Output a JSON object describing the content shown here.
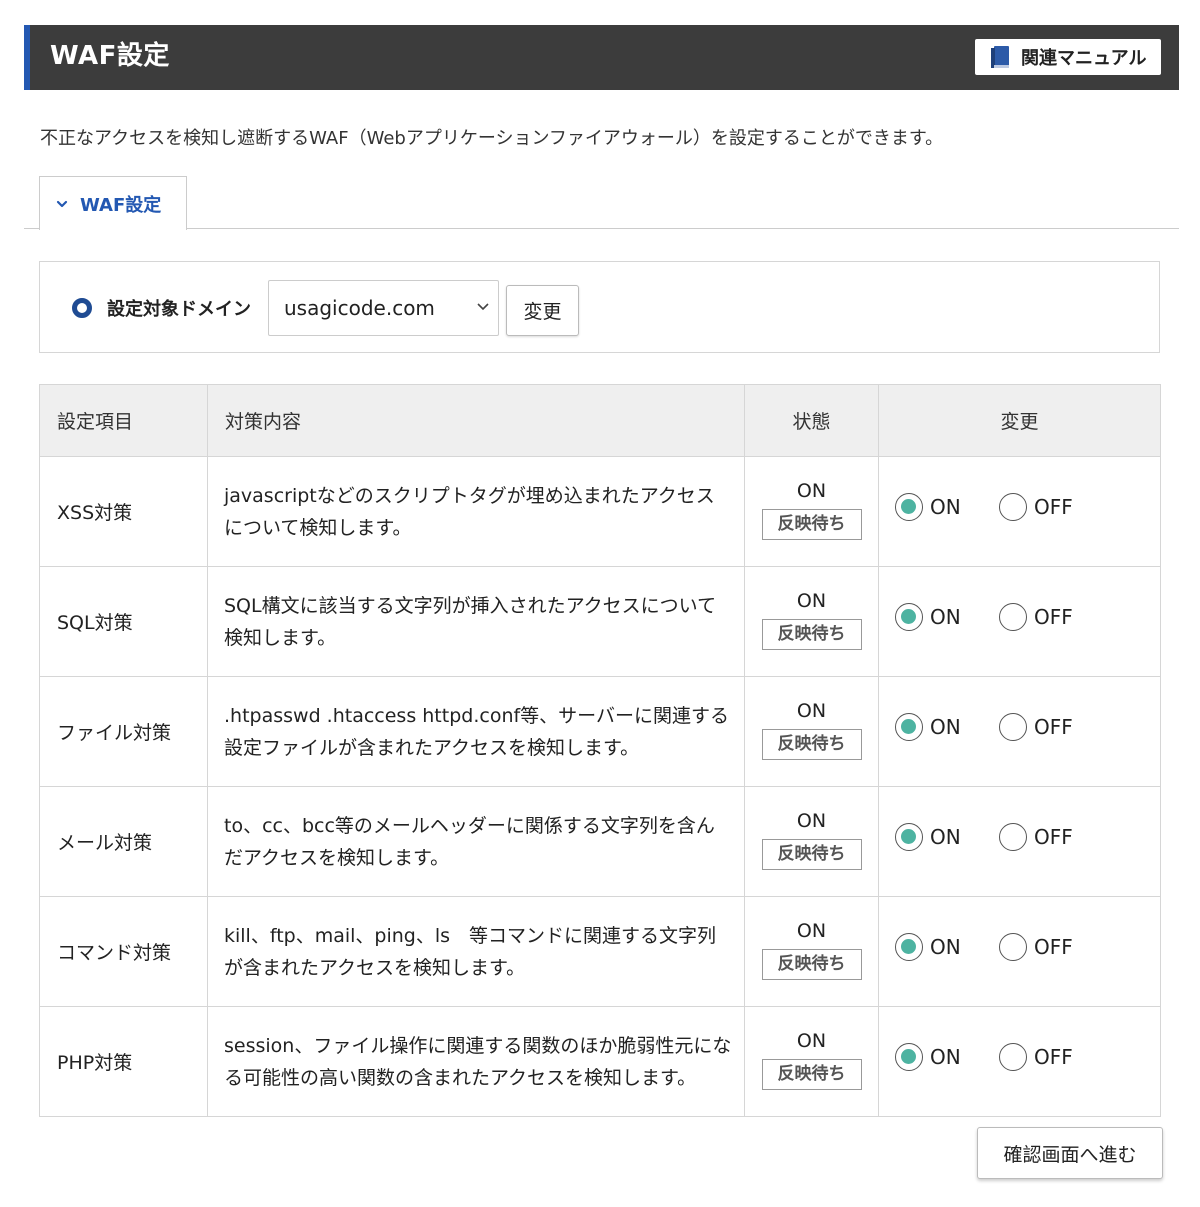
{
  "header": {
    "title": "WAF設定",
    "manual_button": "関連マニュアル",
    "accent_color": "#2358b2"
  },
  "description": "不正なアクセスを検知し遮断するWAF（Webアプリケーションファイアウォール）を設定することができます。",
  "tab": {
    "label": "WAF設定"
  },
  "domain": {
    "label": "設定対象ドメイン",
    "selected": "usagicode.com",
    "change_button": "変更"
  },
  "table": {
    "headers": {
      "item": "設定項目",
      "description": "対策内容",
      "state": "状態",
      "change": "変更"
    },
    "on_label": "ON",
    "off_label": "OFF",
    "rows": [
      {
        "item": "XSS対策",
        "description": "javascriptなどのスクリプトタグが埋め込まれたアクセスについて検知します。",
        "state": "ON",
        "badge": "反映待ち",
        "selected": "ON"
      },
      {
        "item": "SQL対策",
        "description": "SQL構文に該当する文字列が挿入されたアクセスについて検知します。",
        "state": "ON",
        "badge": "反映待ち",
        "selected": "ON"
      },
      {
        "item": "ファイル対策",
        "description": ".htpasswd .htaccess httpd.conf等、サーバーに関連する設定ファイルが含まれたアクセスを検知します。",
        "state": "ON",
        "badge": "反映待ち",
        "selected": "ON"
      },
      {
        "item": "メール対策",
        "description": "to、cc、bcc等のメールヘッダーに関係する文字列を含んだアクセスを検知します。",
        "state": "ON",
        "badge": "反映待ち",
        "selected": "ON"
      },
      {
        "item": "コマンド対策",
        "description": "kill、ftp、mail、ping、ls　等コマンドに関連する文字列が含まれたアクセスを検知します。",
        "state": "ON",
        "badge": "反映待ち",
        "selected": "ON"
      },
      {
        "item": "PHP対策",
        "description": "session、ファイル操作に関連する関数のほか脆弱性元になる可能性の高い関数の含まれたアクセスを検知します。",
        "state": "ON",
        "badge": "反映待ち",
        "selected": "ON"
      }
    ]
  },
  "confirm_button": "確認画面へ進む",
  "colors": {
    "header_bg": "#3c3c3c",
    "radio_checked": "#4db3a1",
    "tab_text": "#2358b2"
  }
}
